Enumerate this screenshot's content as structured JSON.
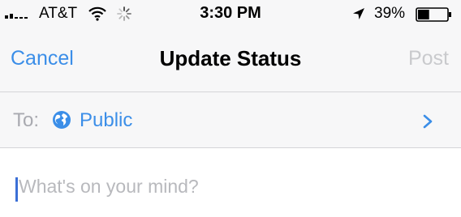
{
  "status_bar": {
    "carrier": "AT&T",
    "time": "3:30 PM",
    "battery_percent": "39%",
    "battery_level": 0.39,
    "icons": [
      "signal-bars-icon",
      "wifi-icon",
      "activity-spinner-icon",
      "location-arrow-icon",
      "battery-icon"
    ]
  },
  "nav": {
    "cancel_label": "Cancel",
    "title": "Update Status",
    "post_label": "Post"
  },
  "audience": {
    "to_label": "To:",
    "value": "Public",
    "icon": "globe-icon",
    "disclosure_icon": "chevron-right-icon"
  },
  "composer": {
    "placeholder": "What's on your mind?"
  },
  "colors": {
    "accent": "#3b8ee8",
    "disabled": "#c9cacd",
    "muted_text": "#a9aab0",
    "bar_background": "#f7f7f8"
  }
}
